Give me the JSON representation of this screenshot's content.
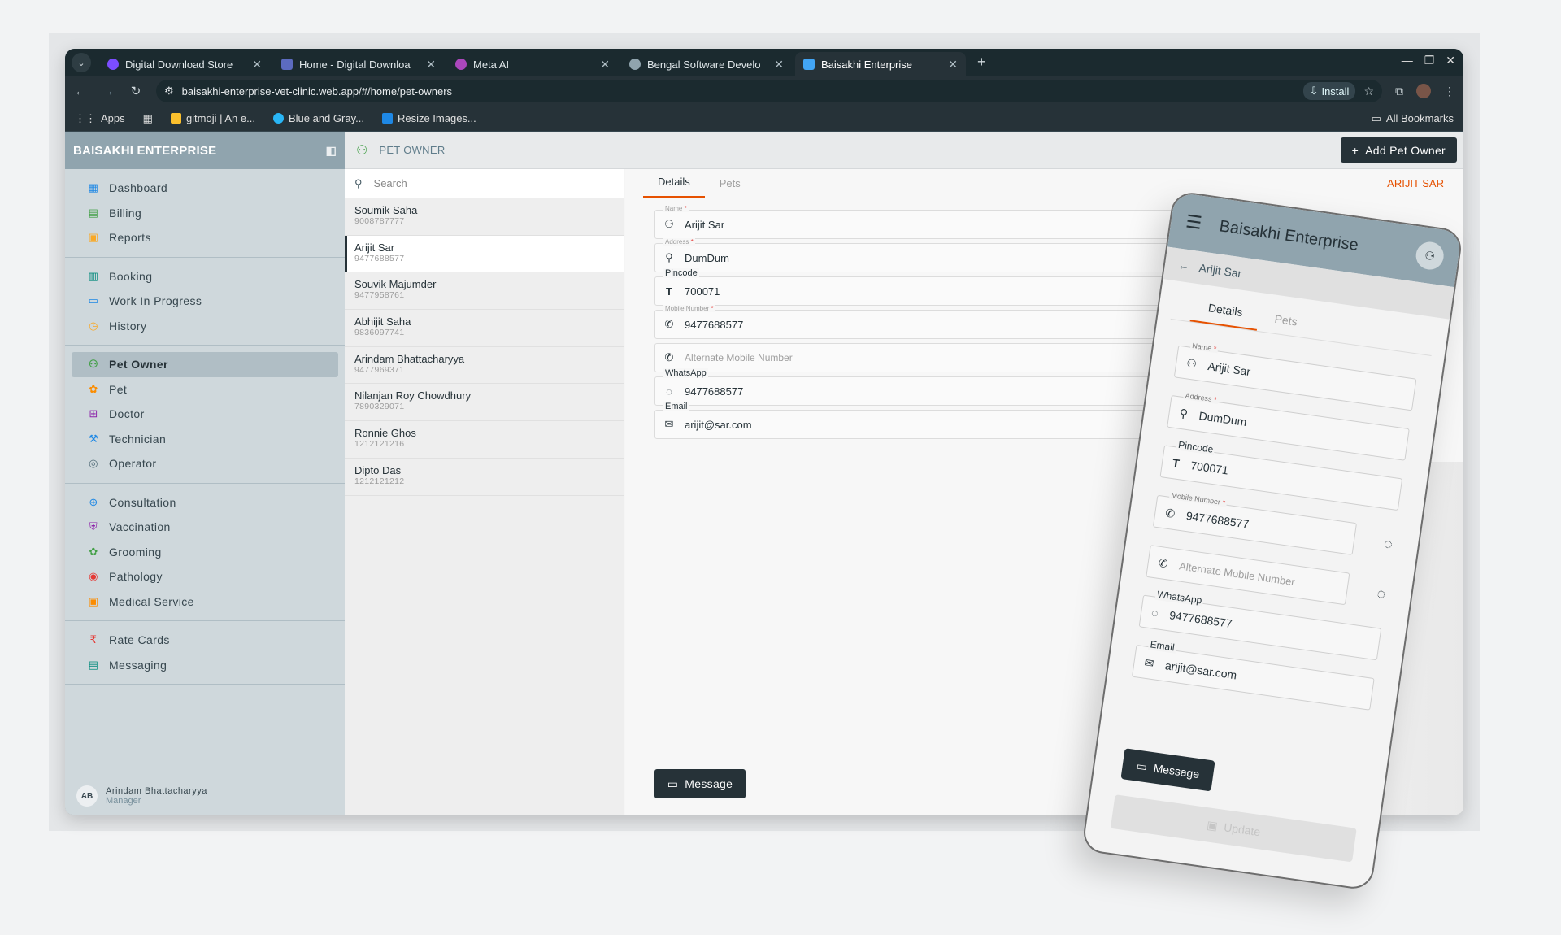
{
  "browser": {
    "tabs": [
      {
        "label": "Digital Download Store",
        "color": "#7c4dff"
      },
      {
        "label": "Home - Digital Downloa",
        "color": "#5c6bc0"
      },
      {
        "label": "Meta AI",
        "color": "#ab47bc"
      },
      {
        "label": "Bengal Software Develo",
        "color": "#90a4ae"
      },
      {
        "label": "Baisakhi Enterprise",
        "color": "#42a5f5"
      }
    ],
    "url": "baisakhi-enterprise-vet-clinic.web.app/#/home/pet-owners",
    "install_label": "Install",
    "bookmarks": [
      {
        "label": "Apps"
      },
      {
        "label": "gitmoji | An e..."
      },
      {
        "label": "Blue and Gray..."
      },
      {
        "label": "Resize Images..."
      }
    ],
    "all_bookmarks": "All Bookmarks"
  },
  "sidebar": {
    "brand": "BAISAKHI ENTERPRISE",
    "groups": [
      [
        {
          "label": "Dashboard",
          "icon": "dashboard-icon",
          "glyph": "▦",
          "color": "#1e88e5"
        },
        {
          "label": "Billing",
          "icon": "billing-icon",
          "glyph": "▤",
          "color": "#43a047"
        },
        {
          "label": "Reports",
          "icon": "reports-icon",
          "glyph": "▣",
          "color": "#f9a825"
        }
      ],
      [
        {
          "label": "Booking",
          "icon": "booking-icon",
          "glyph": "▥",
          "color": "#00897b"
        },
        {
          "label": "Work In Progress",
          "icon": "briefcase-icon",
          "glyph": "▭",
          "color": "#1e88e5"
        },
        {
          "label": "History",
          "icon": "history-icon",
          "glyph": "◷",
          "color": "#f9a825"
        }
      ],
      [
        {
          "label": "Pet Owner",
          "icon": "pet-owner-icon",
          "glyph": "⚇",
          "color": "#43a047",
          "active": true
        },
        {
          "label": "Pet",
          "icon": "paw-icon",
          "glyph": "✿",
          "color": "#fb8c00"
        },
        {
          "label": "Doctor",
          "icon": "doctor-icon",
          "glyph": "⊞",
          "color": "#8e24aa"
        },
        {
          "label": "Technician",
          "icon": "wrench-icon",
          "glyph": "⚒",
          "color": "#1e88e5"
        },
        {
          "label": "Operator",
          "icon": "operator-icon",
          "glyph": "◎",
          "color": "#546e7a"
        }
      ],
      [
        {
          "label": "Consultation",
          "icon": "consultation-icon",
          "glyph": "⊕",
          "color": "#1e88e5"
        },
        {
          "label": "Vaccination",
          "icon": "shield-icon",
          "glyph": "⛨",
          "color": "#8e24aa"
        },
        {
          "label": "Grooming",
          "icon": "grooming-icon",
          "glyph": "✿",
          "color": "#43a047"
        },
        {
          "label": "Pathology",
          "icon": "pathology-icon",
          "glyph": "◉",
          "color": "#e53935"
        },
        {
          "label": "Medical Service",
          "icon": "medical-kit-icon",
          "glyph": "▣",
          "color": "#fb8c00"
        }
      ],
      [
        {
          "label": "Rate Cards",
          "icon": "rupee-icon",
          "glyph": "₹",
          "color": "#e53935"
        },
        {
          "label": "Messaging",
          "icon": "messaging-icon",
          "glyph": "▤",
          "color": "#00897b"
        }
      ]
    ],
    "user": {
      "initials": "AB",
      "name": "Arindam Bhattacharyya",
      "role": "Manager"
    }
  },
  "topbar": {
    "title": "PET OWNER",
    "add_button": "Add Pet Owner"
  },
  "search": {
    "placeholder": "Search"
  },
  "owners": [
    {
      "name": "Soumik Saha",
      "phone": "9008787777"
    },
    {
      "name": "Arijit Sar",
      "phone": "9477688577",
      "active": true
    },
    {
      "name": "Souvik Majumder",
      "phone": "9477958761"
    },
    {
      "name": "Abhijit Saha",
      "phone": "9836097741"
    },
    {
      "name": "Arindam Bhattacharyya",
      "phone": "9477969371"
    },
    {
      "name": "Nilanjan Roy Chowdhury",
      "phone": "7890329071"
    },
    {
      "name": "Ronnie Ghos",
      "phone": "1212121216"
    },
    {
      "name": "Dipto Das",
      "phone": "1212121212"
    }
  ],
  "detail": {
    "tabs": [
      "Details",
      "Pets"
    ],
    "owner_tag": "ARIJIT SAR",
    "fields": {
      "name": {
        "label": "Name",
        "value": "Arijit Sar"
      },
      "address": {
        "label": "Address",
        "value": "DumDum"
      },
      "pincode": {
        "label": "Pincode",
        "value": "700071"
      },
      "mobile": {
        "label": "Mobile Number",
        "value": "9477688577"
      },
      "alt_mobile": {
        "placeholder": "Alternate Mobile Number"
      },
      "whatsapp": {
        "label": "WhatsApp",
        "value": "9477688577"
      },
      "email": {
        "label": "Email",
        "value": "arijit@sar.com"
      }
    },
    "message_button": "Message"
  },
  "phone": {
    "title": "Baisakhi Enterprise",
    "back_label": "Arijit Sar",
    "tabs": [
      "Details",
      "Pets"
    ],
    "update_button": "Update"
  }
}
